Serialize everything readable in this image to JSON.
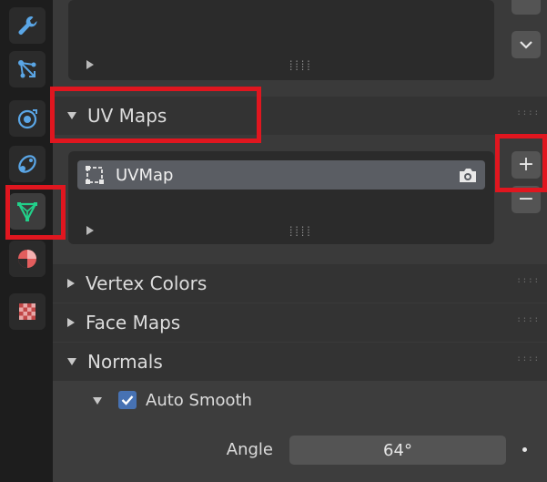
{
  "sidebar": {
    "tabs": [
      {
        "icon": "wrench-icon"
      },
      {
        "icon": "particles-icon"
      },
      {
        "icon": "physics-icon"
      },
      {
        "icon": "constraints-icon"
      },
      {
        "icon": "mesh-data-icon",
        "active": true
      },
      {
        "icon": "material-icon"
      },
      {
        "icon": "texture-icon"
      }
    ]
  },
  "uv_maps": {
    "header": "UV Maps",
    "items": [
      {
        "name": "UVMap"
      }
    ],
    "add_label": "+",
    "remove_label": "−"
  },
  "vertex_colors": {
    "header": "Vertex Colors"
  },
  "face_maps": {
    "header": "Face Maps"
  },
  "normals": {
    "header": "Normals",
    "auto_smooth": {
      "label": "Auto Smooth",
      "checked": true
    },
    "angle": {
      "label": "Angle",
      "value": "64°"
    }
  },
  "colors": {
    "highlight": "#e0161f",
    "active_tab_icon": "#22d08a",
    "checkbox": "#4772b3"
  }
}
